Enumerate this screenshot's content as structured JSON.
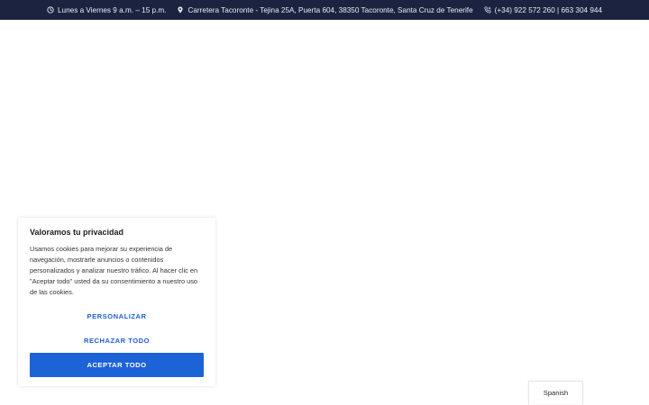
{
  "topbar": {
    "hours": "Lunes a Viernes 9 a.m. – 15 p.m.",
    "address": "Carretera Tacoronte - Tejina 25A, Puerta 604, 38350 Tacoronte, Santa Cruz de Tenerife",
    "phone": "(+34) 922 572 260 | 663 304 944",
    "background_color": "#1c2340"
  },
  "cookie_banner": {
    "title": "Valoramos tu privacidad",
    "body": "Usamos cookies para mejorar su experiencia de navegación, mostrarle anuncios o contenidos personalizados y analizar nuestro tráfico. Al hacer clic en \"Aceptar todo\" usted da su consentimiento a nuestro uso de las cookies.",
    "customize_label": "PERSONALIZAR",
    "reject_label": "RECHAZAR TODO",
    "accept_label": "ACEPTAR TODO",
    "accent_color": "#1c63d8"
  },
  "language_switcher": {
    "label": "Spanish"
  },
  "icons": {
    "hours": "clock-icon",
    "address": "map-pin-icon",
    "phone": "phone-icon"
  }
}
